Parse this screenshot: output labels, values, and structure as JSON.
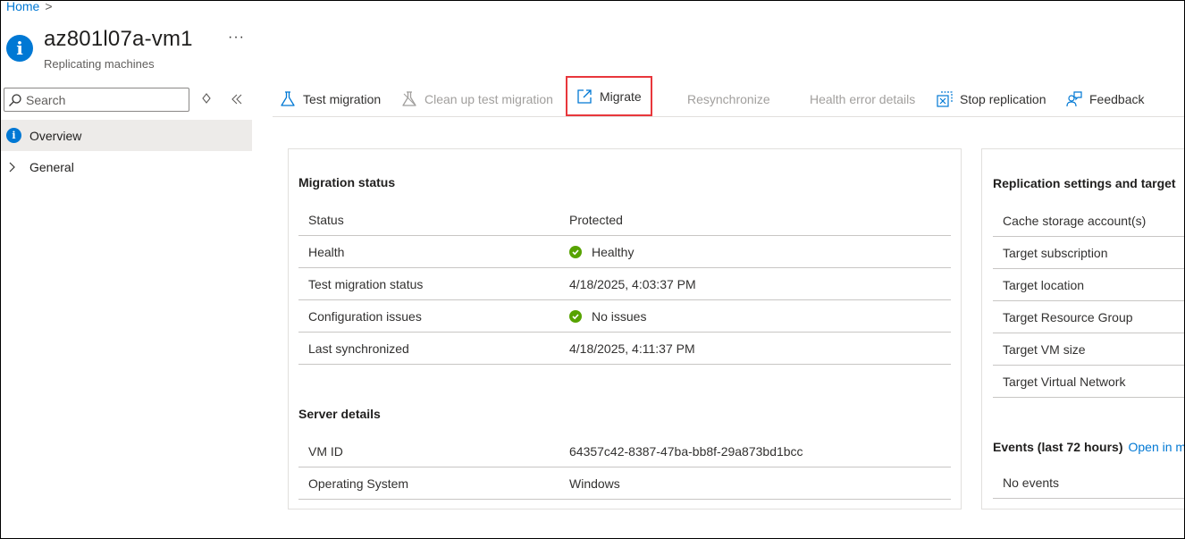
{
  "breadcrumb": {
    "home": "Home",
    "separator": ">"
  },
  "header": {
    "title": "az801l07a-vm1",
    "subtitle": "Replicating machines",
    "more": "···",
    "icon": "info-icon"
  },
  "sidebar": {
    "search_placeholder": "Search",
    "items": [
      {
        "label": "Overview",
        "icon": "info-icon",
        "selected": true
      },
      {
        "label": "General",
        "icon": "chevron-right-icon",
        "selected": false
      }
    ]
  },
  "toolbar": {
    "test_migration": "Test migration",
    "cleanup": "Clean up test migration",
    "migrate": "Migrate",
    "resync": "Resynchronize",
    "health_error": "Health error details",
    "stop_replication": "Stop replication",
    "feedback": "Feedback"
  },
  "migration_status": {
    "title": "Migration status",
    "rows": [
      {
        "key": "Status",
        "value": "Protected",
        "ok": false
      },
      {
        "key": "Health",
        "value": "Healthy",
        "ok": true
      },
      {
        "key": "Test migration status",
        "value": "4/18/2025, 4:03:37 PM",
        "ok": false
      },
      {
        "key": "Configuration issues",
        "value": "No issues",
        "ok": true
      },
      {
        "key": "Last synchronized",
        "value": "4/18/2025, 4:11:37 PM",
        "ok": false
      }
    ]
  },
  "server_details": {
    "title": "Server details",
    "rows": [
      {
        "key": "VM ID",
        "value": "64357c42-8387-47ba-bb8f-29a873bd1bcc"
      },
      {
        "key": "Operating System",
        "value": "Windows"
      }
    ]
  },
  "replication_settings": {
    "title": "Replication settings and target",
    "rows": [
      "Cache storage account(s)",
      "Target subscription",
      "Target location",
      "Target Resource Group",
      "Target VM size",
      "Target Virtual Network"
    ]
  },
  "events": {
    "title": "Events (last 72 hours)",
    "link": "Open in m",
    "empty": "No events"
  },
  "colors": {
    "accent": "#0078d4",
    "highlight": "#e8373c",
    "success": "#57a300",
    "disabled": "#a19f9d"
  }
}
